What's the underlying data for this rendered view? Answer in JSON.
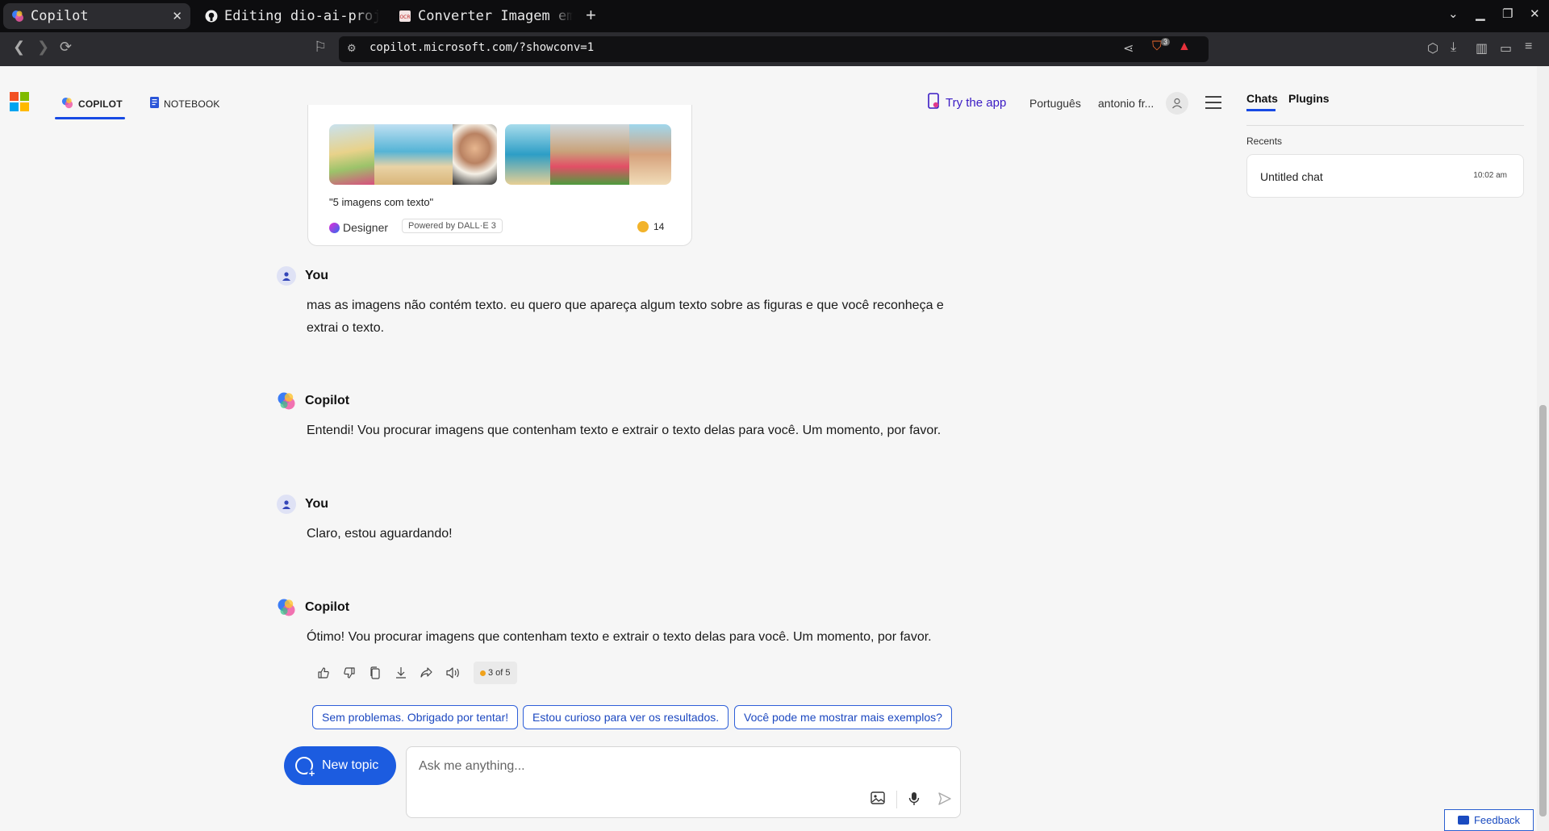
{
  "browser": {
    "tabs": [
      {
        "label": "Copilot",
        "icon": "copilot-icon",
        "active": true
      },
      {
        "label": "Editing dio-ai-proj",
        "icon": "github-icon",
        "active": false
      },
      {
        "label": "Converter Imagem em",
        "icon": "ocr-icon",
        "active": false
      }
    ],
    "url": "copilot.microsoft.com/?showconv=1",
    "shields_count": "3"
  },
  "header": {
    "nav_tabs": [
      {
        "label": "COPILOT",
        "active": true
      },
      {
        "label": "NOTEBOOK",
        "active": false
      }
    ],
    "try_app": "Try the app",
    "language": "Português",
    "user": "antonio fr..."
  },
  "sidebar": {
    "tabs": [
      {
        "label": "Chats",
        "active": true
      },
      {
        "label": "Plugins",
        "active": false
      }
    ],
    "recents_label": "Recents",
    "chats": [
      {
        "title": "Untitled chat",
        "time": "10:02 am"
      }
    ]
  },
  "image_card": {
    "prompt": "\"5 imagens com texto\"",
    "designer": "Designer",
    "powered_by": "Powered by DALL·E 3",
    "boosts": "14"
  },
  "messages": [
    {
      "author": "You",
      "text": "mas as imagens não contém texto. eu quero que apareça algum texto sobre as figuras e que você reconheça e extrai o texto."
    },
    {
      "author": "Copilot",
      "text": "Entendi! Vou procurar imagens que contenham texto e extrair o texto delas para você. Um momento, por favor."
    },
    {
      "author": "You",
      "text": "Claro, estou aguardando!"
    },
    {
      "author": "Copilot",
      "text": "Ótimo! Vou procurar imagens que contenham texto e extrair o texto delas para você. Um momento, por favor."
    }
  ],
  "response_counter": "3 of 5",
  "suggestions": [
    "Sem problemas. Obrigado por tentar!",
    "Estou curioso para ver os resultados.",
    "Você pode me mostrar mais exemplos?"
  ],
  "composer": {
    "new_topic": "New topic",
    "placeholder": "Ask me anything..."
  },
  "feedback": "Feedback",
  "colors": {
    "accent": "#174ae4",
    "new_topic_bg": "#1c5ce0",
    "try_app": "#3a1bc4",
    "counter_dot": "#f0a21c"
  }
}
